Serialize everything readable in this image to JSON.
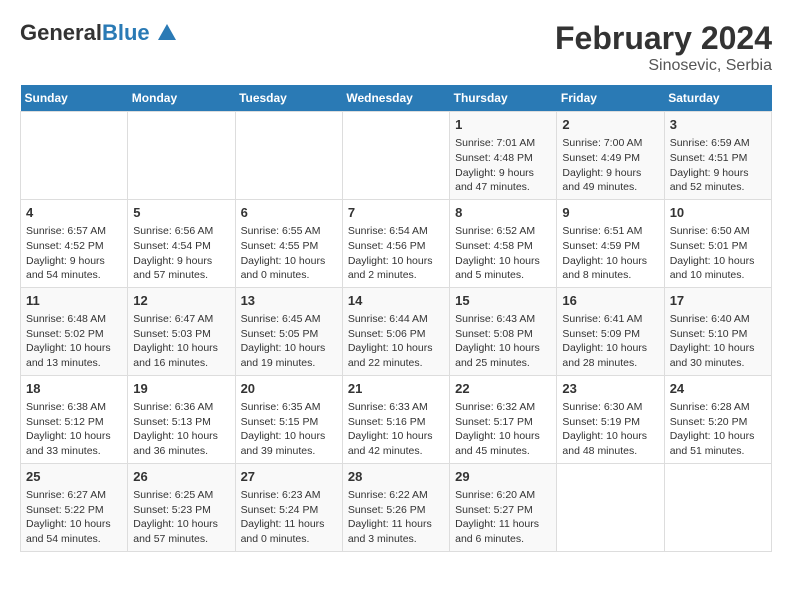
{
  "header": {
    "logo_general": "General",
    "logo_blue": "Blue",
    "month_title": "February 2024",
    "location": "Sinosevic, Serbia"
  },
  "days_of_week": [
    "Sunday",
    "Monday",
    "Tuesday",
    "Wednesday",
    "Thursday",
    "Friday",
    "Saturday"
  ],
  "weeks": [
    [
      {
        "day": "",
        "info": ""
      },
      {
        "day": "",
        "info": ""
      },
      {
        "day": "",
        "info": ""
      },
      {
        "day": "",
        "info": ""
      },
      {
        "day": "1",
        "info": "Sunrise: 7:01 AM\nSunset: 4:48 PM\nDaylight: 9 hours\nand 47 minutes."
      },
      {
        "day": "2",
        "info": "Sunrise: 7:00 AM\nSunset: 4:49 PM\nDaylight: 9 hours\nand 49 minutes."
      },
      {
        "day": "3",
        "info": "Sunrise: 6:59 AM\nSunset: 4:51 PM\nDaylight: 9 hours\nand 52 minutes."
      }
    ],
    [
      {
        "day": "4",
        "info": "Sunrise: 6:57 AM\nSunset: 4:52 PM\nDaylight: 9 hours\nand 54 minutes."
      },
      {
        "day": "5",
        "info": "Sunrise: 6:56 AM\nSunset: 4:54 PM\nDaylight: 9 hours\nand 57 minutes."
      },
      {
        "day": "6",
        "info": "Sunrise: 6:55 AM\nSunset: 4:55 PM\nDaylight: 10 hours\nand 0 minutes."
      },
      {
        "day": "7",
        "info": "Sunrise: 6:54 AM\nSunset: 4:56 PM\nDaylight: 10 hours\nand 2 minutes."
      },
      {
        "day": "8",
        "info": "Sunrise: 6:52 AM\nSunset: 4:58 PM\nDaylight: 10 hours\nand 5 minutes."
      },
      {
        "day": "9",
        "info": "Sunrise: 6:51 AM\nSunset: 4:59 PM\nDaylight: 10 hours\nand 8 minutes."
      },
      {
        "day": "10",
        "info": "Sunrise: 6:50 AM\nSunset: 5:01 PM\nDaylight: 10 hours\nand 10 minutes."
      }
    ],
    [
      {
        "day": "11",
        "info": "Sunrise: 6:48 AM\nSunset: 5:02 PM\nDaylight: 10 hours\nand 13 minutes."
      },
      {
        "day": "12",
        "info": "Sunrise: 6:47 AM\nSunset: 5:03 PM\nDaylight: 10 hours\nand 16 minutes."
      },
      {
        "day": "13",
        "info": "Sunrise: 6:45 AM\nSunset: 5:05 PM\nDaylight: 10 hours\nand 19 minutes."
      },
      {
        "day": "14",
        "info": "Sunrise: 6:44 AM\nSunset: 5:06 PM\nDaylight: 10 hours\nand 22 minutes."
      },
      {
        "day": "15",
        "info": "Sunrise: 6:43 AM\nSunset: 5:08 PM\nDaylight: 10 hours\nand 25 minutes."
      },
      {
        "day": "16",
        "info": "Sunrise: 6:41 AM\nSunset: 5:09 PM\nDaylight: 10 hours\nand 28 minutes."
      },
      {
        "day": "17",
        "info": "Sunrise: 6:40 AM\nSunset: 5:10 PM\nDaylight: 10 hours\nand 30 minutes."
      }
    ],
    [
      {
        "day": "18",
        "info": "Sunrise: 6:38 AM\nSunset: 5:12 PM\nDaylight: 10 hours\nand 33 minutes."
      },
      {
        "day": "19",
        "info": "Sunrise: 6:36 AM\nSunset: 5:13 PM\nDaylight: 10 hours\nand 36 minutes."
      },
      {
        "day": "20",
        "info": "Sunrise: 6:35 AM\nSunset: 5:15 PM\nDaylight: 10 hours\nand 39 minutes."
      },
      {
        "day": "21",
        "info": "Sunrise: 6:33 AM\nSunset: 5:16 PM\nDaylight: 10 hours\nand 42 minutes."
      },
      {
        "day": "22",
        "info": "Sunrise: 6:32 AM\nSunset: 5:17 PM\nDaylight: 10 hours\nand 45 minutes."
      },
      {
        "day": "23",
        "info": "Sunrise: 6:30 AM\nSunset: 5:19 PM\nDaylight: 10 hours\nand 48 minutes."
      },
      {
        "day": "24",
        "info": "Sunrise: 6:28 AM\nSunset: 5:20 PM\nDaylight: 10 hours\nand 51 minutes."
      }
    ],
    [
      {
        "day": "25",
        "info": "Sunrise: 6:27 AM\nSunset: 5:22 PM\nDaylight: 10 hours\nand 54 minutes."
      },
      {
        "day": "26",
        "info": "Sunrise: 6:25 AM\nSunset: 5:23 PM\nDaylight: 10 hours\nand 57 minutes."
      },
      {
        "day": "27",
        "info": "Sunrise: 6:23 AM\nSunset: 5:24 PM\nDaylight: 11 hours\nand 0 minutes."
      },
      {
        "day": "28",
        "info": "Sunrise: 6:22 AM\nSunset: 5:26 PM\nDaylight: 11 hours\nand 3 minutes."
      },
      {
        "day": "29",
        "info": "Sunrise: 6:20 AM\nSunset: 5:27 PM\nDaylight: 11 hours\nand 6 minutes."
      },
      {
        "day": "",
        "info": ""
      },
      {
        "day": "",
        "info": ""
      }
    ]
  ]
}
